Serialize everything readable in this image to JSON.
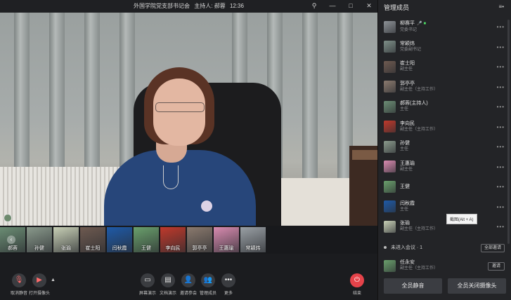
{
  "titlebar": {
    "meeting_title": "外国学院党支部书记会",
    "host_label": "主持人: 郝蓉",
    "time": "12:36",
    "pin_icon": "pin-icon",
    "minimize": "—",
    "maximize": "□",
    "close": "✕"
  },
  "thumbnails": [
    {
      "name": "郝蓉",
      "color": "#6b8d74"
    },
    {
      "name": "孙健",
      "color": "#8a9a8c"
    },
    {
      "name": "张瑜",
      "color": "#c8d0b6"
    },
    {
      "name": "崔士阳",
      "color": "#6e5a50"
    },
    {
      "name": "闫秋霞",
      "color": "#1e5aa8"
    },
    {
      "name": "王健",
      "color": "#6aa06c"
    },
    {
      "name": "李向民",
      "color": "#c0392b"
    },
    {
      "name": "郭亭亭",
      "color": "#8b7a6e"
    },
    {
      "name": "王惠瑜",
      "color": "#d98bb0"
    },
    {
      "name": "常颖炜",
      "color": "#9aa0a5"
    }
  ],
  "toolbar": {
    "mute_label": "取消静音",
    "camera_label": "打开摄像头",
    "share_label": "屏幕演示",
    "doc_label": "文档演示",
    "invite_label": "邀请参会",
    "manage_label": "管理成员",
    "more_label": "更多",
    "end_label": "结束"
  },
  "panel": {
    "title": "管理成员",
    "members": [
      {
        "name": "柳赛平",
        "role": "党委书记",
        "color": "#8d9297",
        "mic": true
      },
      {
        "name": "常颖炜",
        "role": "党委副书记",
        "color": "#7e8f88"
      },
      {
        "name": "崔士阳",
        "role": "副主任",
        "color": "#6e5a50"
      },
      {
        "name": "郭亭亭",
        "role": "副主任（主持工作）",
        "color": "#8b7a6e"
      },
      {
        "name": "郝蓉(主持人)",
        "role": "主任",
        "color": "#6b8d74"
      },
      {
        "name": "李向民",
        "role": "副主任（主持工作）",
        "color": "#c0392b"
      },
      {
        "name": "孙健",
        "role": "主任",
        "color": "#8a9a8c"
      },
      {
        "name": "王惠瑜",
        "role": "副主任",
        "color": "#d98bb0"
      },
      {
        "name": "王健",
        "role": "",
        "color": "#6aa06c"
      },
      {
        "name": "闫秋霞",
        "role": "主任",
        "color": "#1e5aa8"
      },
      {
        "name": "张瑜",
        "role": "副主任（主持工作）",
        "color": "#c8d0b6"
      }
    ],
    "tooltip": "截图(Alt + A)",
    "not_joined_label": "未进入会议 · 1",
    "invite_all": "全部邀请",
    "pending_member": {
      "name": "任永安",
      "role": "副主任（主持工作）",
      "color": "#6aa06c"
    },
    "invite_one": "邀请",
    "mute_all": "全员静音",
    "camera_off_all": "全员关闭摄像头"
  }
}
